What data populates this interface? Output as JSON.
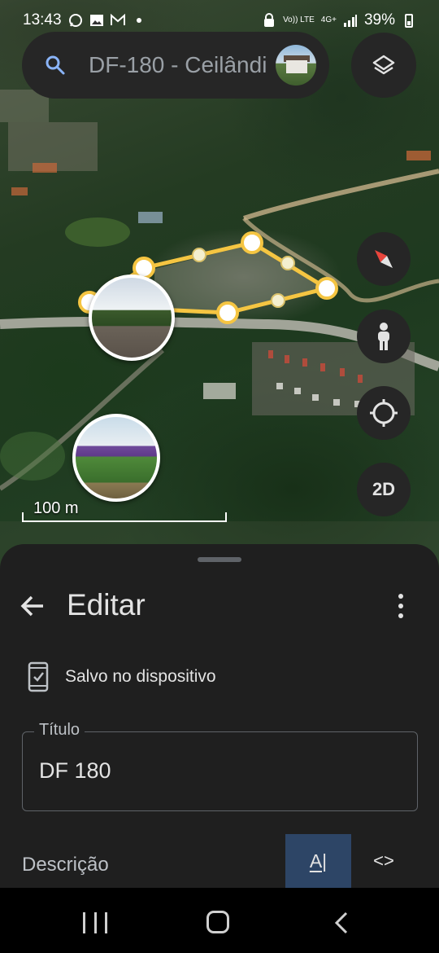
{
  "status_bar": {
    "time": "13:43",
    "battery": "39%",
    "network_labels": [
      "Vo)) LTE",
      "4G+"
    ],
    "icons": [
      "whatsapp-icon",
      "gallery-icon",
      "gmail-icon",
      "notification-dot-icon",
      "lock-icon",
      "signal-icon",
      "battery-icon"
    ]
  },
  "search": {
    "query": "DF-180 - Ceilândia"
  },
  "map": {
    "scale_label": "100 m",
    "buttons": {
      "twod_label": "2D"
    },
    "polygon_color": "#f5c542"
  },
  "sheet": {
    "title": "Editar",
    "saved_text": "Salvo no dispositivo",
    "title_field": {
      "label": "Título",
      "value": "DF 180"
    },
    "description_label": "Descrição",
    "format_button_label": "A|",
    "code_button_label": "<>"
  },
  "colors": {
    "sheet_bg": "#1f1f1f",
    "accent_button": "#2d4566",
    "compass_red": "#e8453c"
  }
}
